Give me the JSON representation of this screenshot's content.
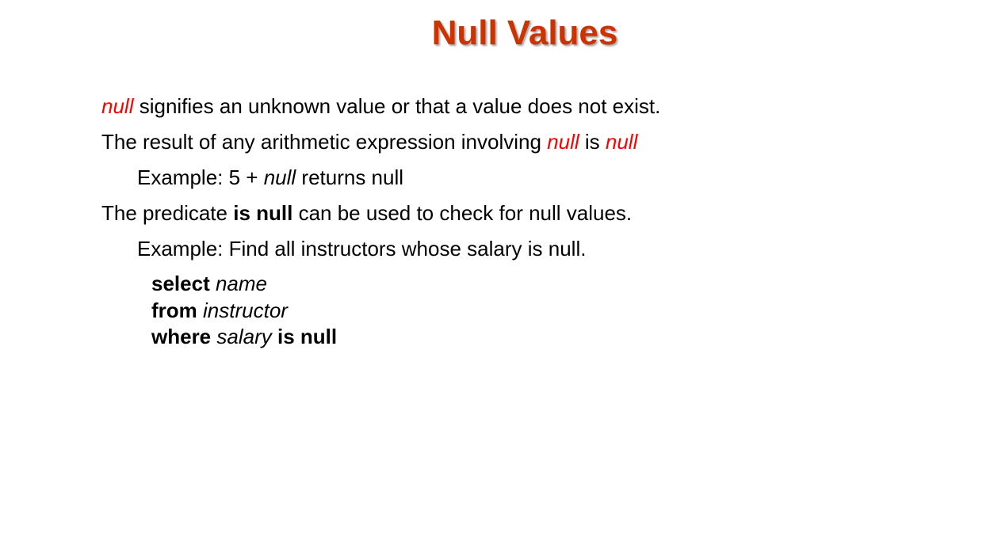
{
  "slide": {
    "title": "Null Values",
    "line1": {
      "null_word": "null",
      "rest": " signifies an unknown value or that a value does not exist."
    },
    "line2": {
      "prefix": "The result of any arithmetic expression involving ",
      "null_word_1": "null",
      "middle": " is ",
      "null_word_2": "null"
    },
    "line3": {
      "prefix": "Example:  5 + ",
      "null_word": "null",
      "suffix": "  returns null"
    },
    "line4": {
      "prefix": "The predicate  ",
      "keyword": "is null",
      "suffix": " can be used to check for null values."
    },
    "line5": {
      "text": "Example: Find all instructors whose salary is null."
    },
    "query": {
      "select_kw": "select",
      "select_attr": "name",
      "from_kw": "from",
      "from_rel": "instructor",
      "where_kw": "where",
      "where_attr": "salary",
      "where_pred": "is null"
    }
  },
  "colors": {
    "title": "#cc3300",
    "null_highlight": "#ff0000"
  }
}
